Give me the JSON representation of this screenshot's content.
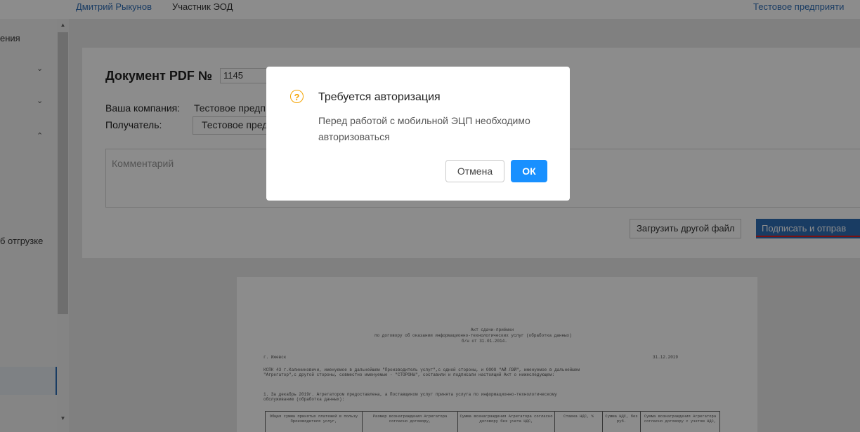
{
  "header": {
    "user_name": "Дмитрий Рыкунов",
    "user_role": "Участник ЭОД",
    "company": "Тестовое предприяти"
  },
  "sidebar": {
    "fragment_top": "ения",
    "fragment_bottom": "б отгрузке",
    "chevron_down": "⌄",
    "chevron_up": "⌃"
  },
  "document": {
    "title": "Документ PDF №",
    "number": "1145",
    "company_label": "Ваша компания:",
    "company_value": "Тестовое предп",
    "recipient_label": "Получатель:",
    "recipient_value": "Тестовое пред",
    "comment_placeholder": "Комментарий",
    "upload_button": "Загрузить другой файл",
    "sign_button": "Подписать и отправ"
  },
  "preview": {
    "heading1": "Акт сдачи-приёмки",
    "heading2": "по договору об оказании информационно-технологических услуг (обработка данных)",
    "heading3": "б/н от 31.01.2014.",
    "city": "г. Ижевск",
    "date": "31.12.2019",
    "para1": "КСПК 43 г.Калиниковичи, именуемое в дальнейшем \"Производитель услуг\",с одной стороны, и  ОООО \"АЙ ЛЭЙ\", именуемое в дальнейшем",
    "para2": "\"Агрегатор\",с другой стороны, совместно именуемые - \"СТОРОНЫ\", составили и подписали настоящий Акт о нижеследующем:",
    "para3": "1. За  декабрь 2019г. Агрегатором  предоставлена,  а  Поставщиком  услуг  принята  услуга  по информационно-технологическому",
    "para4": "обслуживанию (обработка данных):",
    "table_headers": [
      "Общая сумма принятых платежей в пользу Производителя услуг,",
      "Размер вознаграждения Агрегатора согласно договору,",
      "Сумма вознаграждения Агрегатора согласно договору без учета НДС,",
      "Ставка НДС, %",
      "Сумма НДС, без руб.",
      "Сумма вознаграждения Агрегатора согласно договору с учетом НДС,"
    ]
  },
  "dialog": {
    "icon": "question-circle-icon",
    "title": "Требуется авторизация",
    "message": "Перед работой с мобильной ЭЦП необходимо авторизоваться",
    "cancel_label": "Отмена",
    "ok_label": "ОК",
    "ok_color": "#1890ff",
    "warning_color": "#f4a300"
  }
}
